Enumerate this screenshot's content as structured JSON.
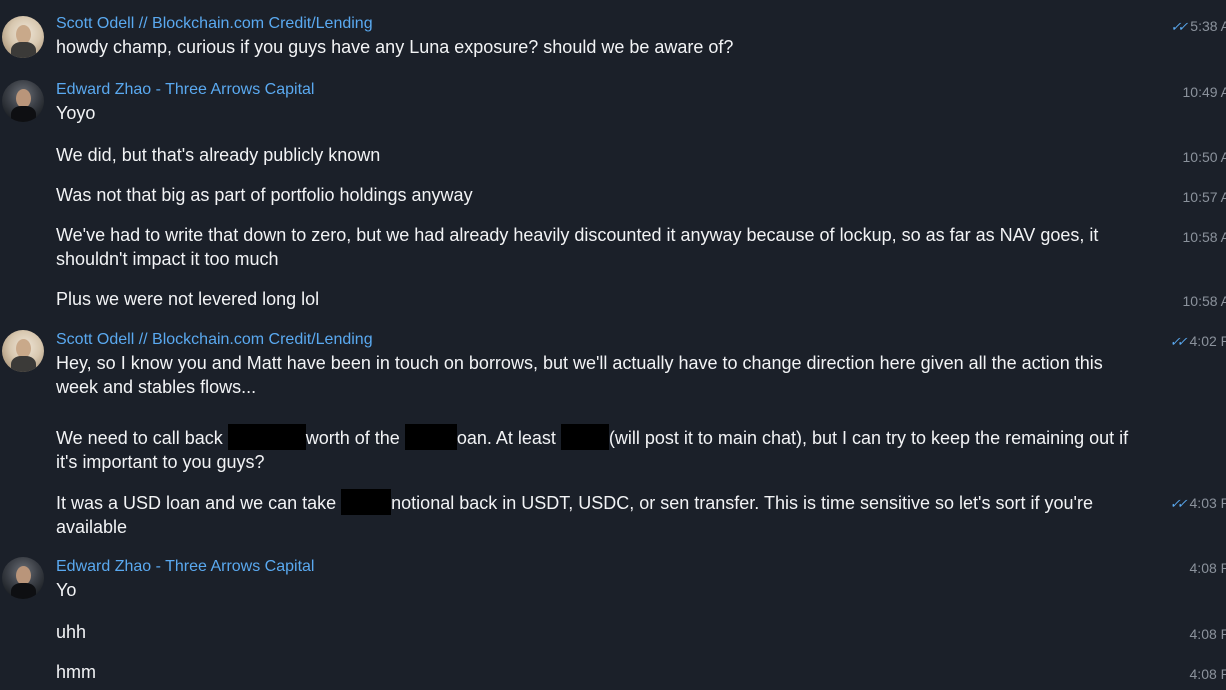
{
  "senders": {
    "scott": "Scott Odell // Blockchain.com Credit/Lending",
    "edward": "Edward Zhao - Three Arrows Capital"
  },
  "icons": {
    "read": "double-check-icon"
  },
  "colors": {
    "background": "#1b2029",
    "sender": "#5aa9f0",
    "text": "#f2f3f5",
    "timestamp": "#8b929c"
  },
  "messages": {
    "m1": {
      "text": "howdy champ, curious if you guys have any Luna exposure? should we be aware of?",
      "time": "5:38 A"
    },
    "m2": {
      "text": "Yoyo",
      "time": "10:49 A"
    },
    "m3": {
      "text": "We did, but that's already publicly known",
      "time": "10:50 A"
    },
    "m4": {
      "text": "Was not that big as part of portfolio holdings anyway",
      "time": "10:57 A"
    },
    "m5": {
      "text": "We've had to write that down to zero, but we had already heavily discounted it anyway because of lockup, so as far as NAV goes, it shouldn't impact it too much",
      "time": "10:58 A"
    },
    "m6": {
      "text": "Plus we were not levered long lol",
      "time": "10:58 A"
    },
    "m7": {
      "text": "Hey, so I know you and Matt have been in touch on borrows, but we'll actually have to change direction here given all the action this week and stables flows...",
      "time": "4:02 P"
    },
    "m8": {
      "p1": "We need to call back ",
      "p2": "worth of the ",
      "p3": "oan. At least ",
      "p4": "(will post it to main chat), but I can try to keep the remaining out if it's important to you guys?"
    },
    "m9": {
      "p1": "It was a USD loan and we can take ",
      "p2": "notional back in USDT, USDC, or sen transfer. This is time sensitive so let's sort if you're available",
      "time": "4:03 P"
    },
    "m10": {
      "text": "Yo",
      "time": "4:08 P"
    },
    "m11": {
      "text": "uhh",
      "time": "4:08 P"
    },
    "m12": {
      "text": "hmm",
      "time": "4:08 P"
    }
  }
}
